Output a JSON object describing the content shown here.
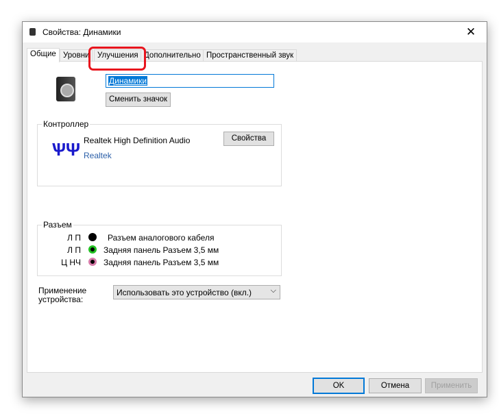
{
  "window": {
    "title": "Свойства: Динамики",
    "close": "✕"
  },
  "tabs": [
    "Общие",
    "Уровни",
    "Улучшения",
    "Дополнительно",
    "Пространственный звук"
  ],
  "device_name": "Динамики",
  "change_icon": "Сменить значок",
  "controller": {
    "legend": "Контроллер",
    "name": "Realtek High Definition Audio",
    "vendor": "Realtek",
    "properties": "Свойства"
  },
  "jacks": {
    "legend": "Разъем",
    "items": [
      {
        "ch": "Л П",
        "label": "Разъем аналогового кабеля",
        "color": "#000000"
      },
      {
        "ch": "Л П",
        "label": "Задняя панель Разъем 3,5 мм",
        "color": "#22c022"
      },
      {
        "ch": "Ц НЧ",
        "label": "Задняя панель Разъем 3,5 мм",
        "color": "#d67aa8"
      }
    ]
  },
  "usage": {
    "label1": "Применение",
    "label2": "устройства:",
    "value": "Использовать это устройство (вкл.)"
  },
  "buttons": {
    "ok": "OK",
    "cancel": "Отмена",
    "apply": "Применить"
  }
}
